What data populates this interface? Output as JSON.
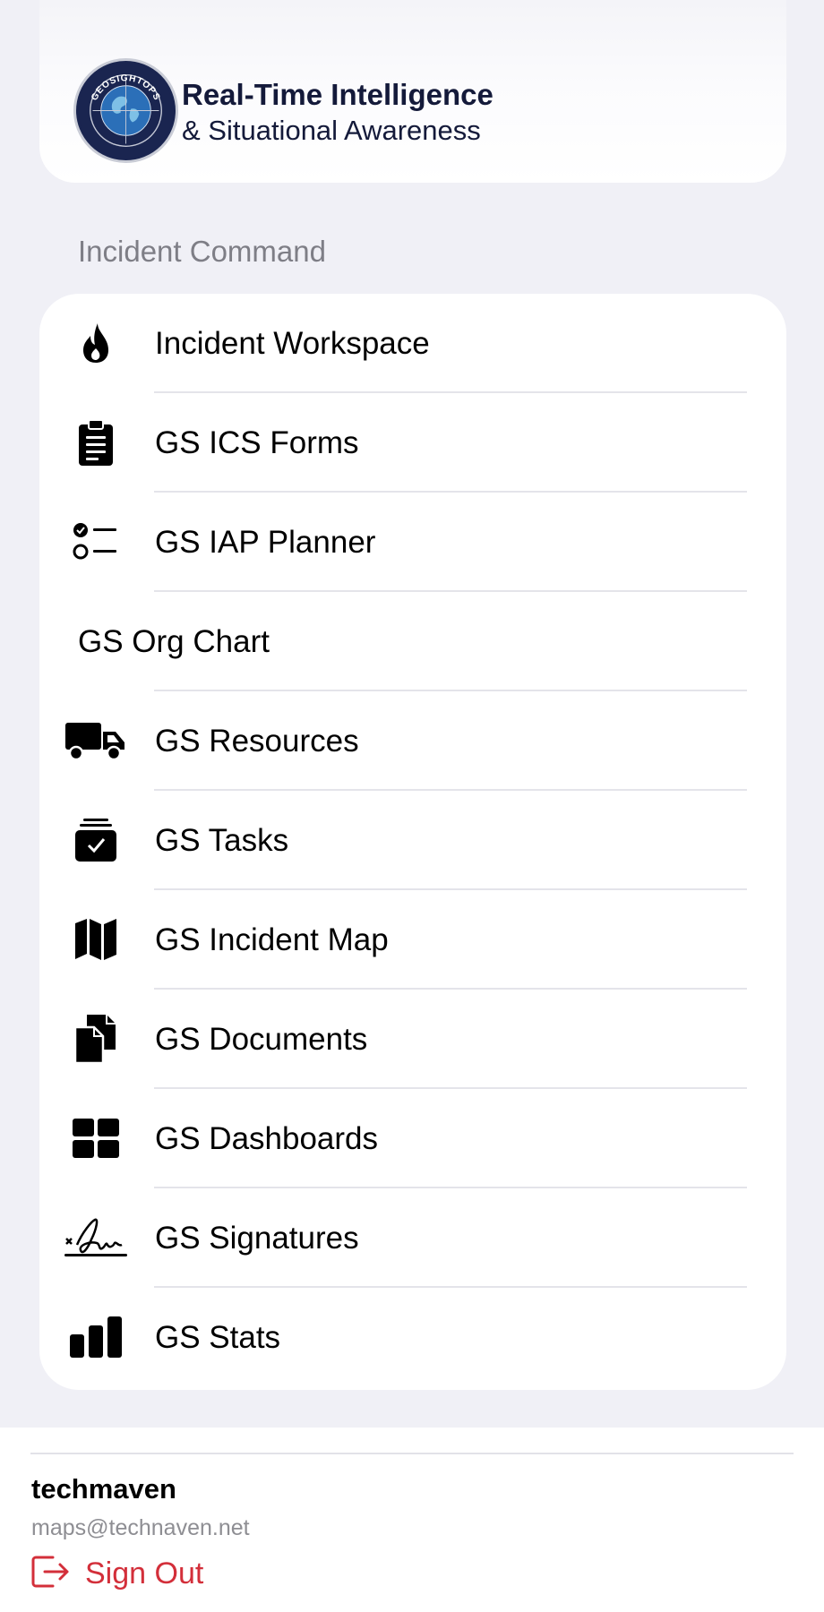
{
  "header": {
    "logo_text": "GEOSIGHTOPS",
    "title": "Real-Time Intelligence",
    "subtitle": "& Situational Awareness"
  },
  "section": {
    "label": "Incident Command"
  },
  "menu": {
    "items": [
      {
        "label": "Incident Workspace",
        "icon": "flame-icon"
      },
      {
        "label": "GS ICS Forms",
        "icon": "clipboard-icon"
      },
      {
        "label": "GS IAP Planner",
        "icon": "checklist-icon"
      },
      {
        "label": "GS Org Chart",
        "icon": ""
      },
      {
        "label": "GS Resources",
        "icon": "truck-icon"
      },
      {
        "label": "GS Tasks",
        "icon": "task-tray-icon"
      },
      {
        "label": "GS Incident Map",
        "icon": "map-icon"
      },
      {
        "label": "GS Documents",
        "icon": "documents-icon"
      },
      {
        "label": "GS Dashboards",
        "icon": "dashboard-grid-icon"
      },
      {
        "label": "GS Signatures",
        "icon": "signature-icon"
      },
      {
        "label": "GS Stats",
        "icon": "bar-chart-icon"
      }
    ]
  },
  "footer": {
    "username": "techmaven",
    "email": "maps@technaven.net",
    "signout_label": "Sign Out"
  },
  "colors": {
    "background": "#f0f0f6",
    "card": "#ffffff",
    "section_label": "#7e7e86",
    "signout": "#d32f3a",
    "header_text": "#141a3a",
    "logo_navy": "#1a2550"
  }
}
